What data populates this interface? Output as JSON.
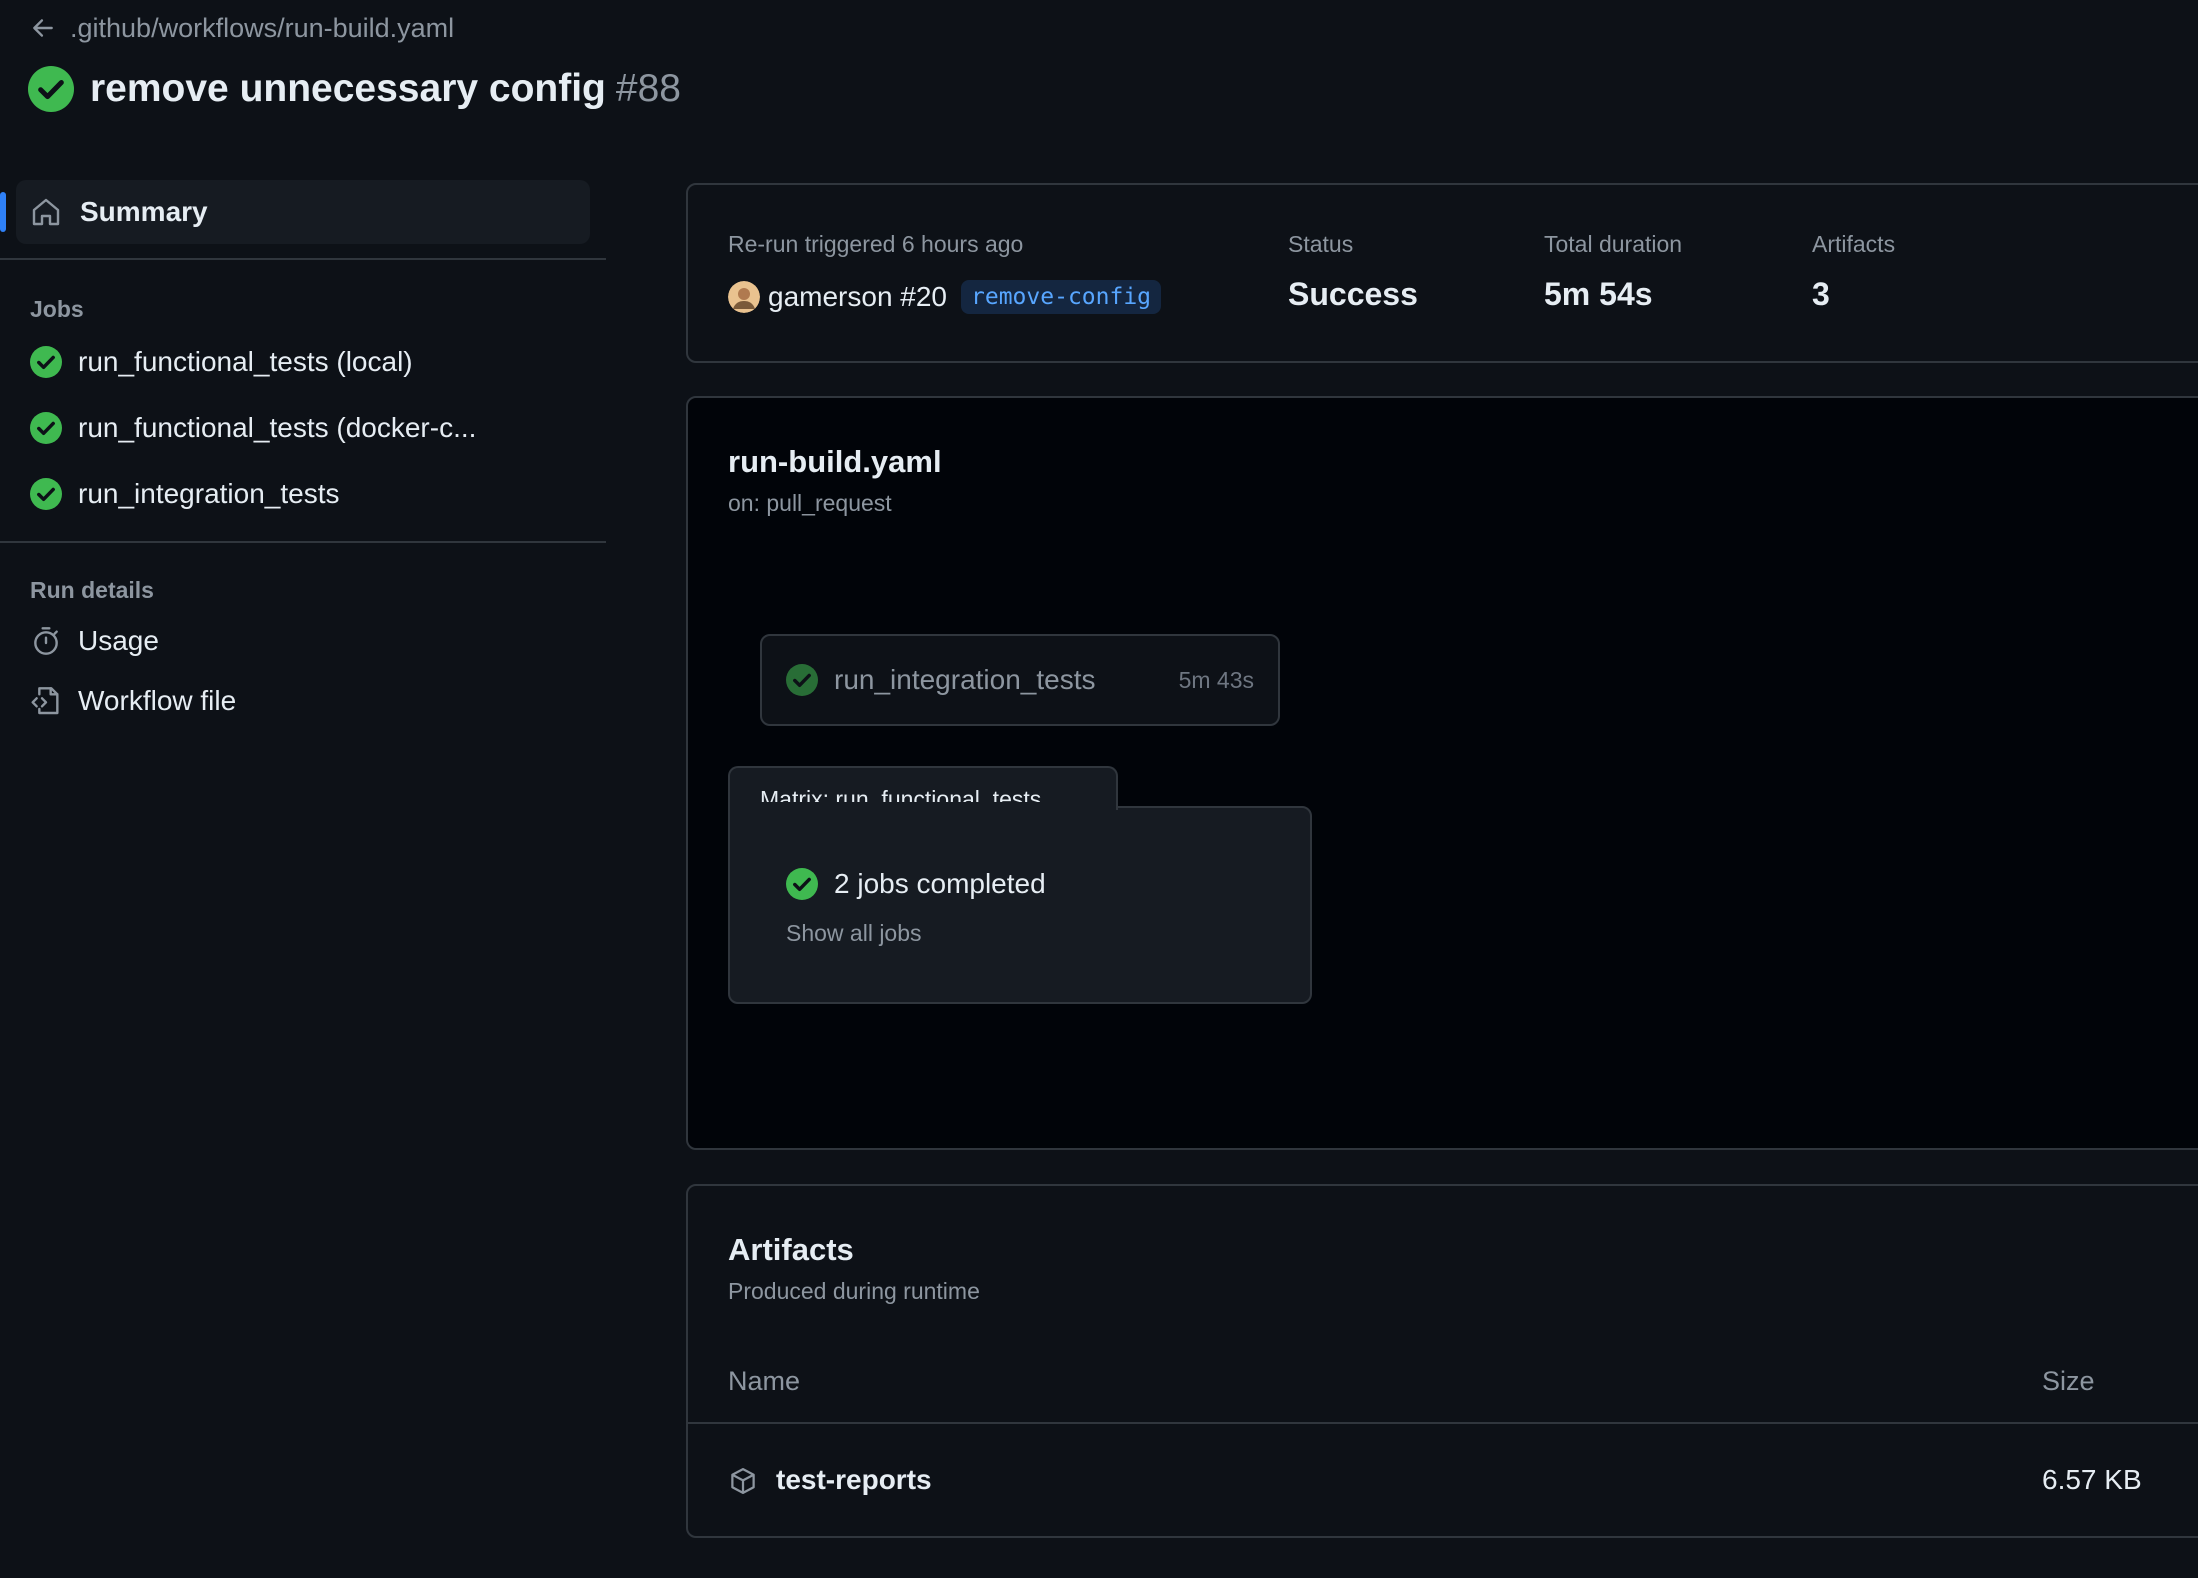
{
  "header": {
    "breadcrumb": ".github/workflows/run-build.yaml",
    "title": "remove unnecessary config",
    "run_number": "#88"
  },
  "sidebar": {
    "summary_label": "Summary",
    "jobs_heading": "Jobs",
    "jobs": [
      {
        "label": "run_functional_tests (local)",
        "status": "success"
      },
      {
        "label": "run_functional_tests (docker-c...",
        "status": "success"
      },
      {
        "label": "run_integration_tests",
        "status": "success"
      }
    ],
    "run_details_heading": "Run details",
    "run_details": [
      {
        "label": "Usage",
        "icon": "stopwatch-icon"
      },
      {
        "label": "Workflow file",
        "icon": "file-code-icon"
      }
    ]
  },
  "summary": {
    "trigger_label": "Re-run triggered 6 hours ago",
    "trigger_user": "gamerson #20",
    "branch": "remove-config",
    "status_label": "Status",
    "status_value": "Success",
    "duration_label": "Total duration",
    "duration_value": "5m 54s",
    "artifacts_label": "Artifacts",
    "artifacts_value": "3"
  },
  "graph": {
    "workflow_name": "run-build.yaml",
    "trigger": "on: pull_request",
    "job": {
      "name": "run_integration_tests",
      "duration": "5m 43s"
    },
    "matrix": {
      "title": "Matrix: run_functional_tests",
      "status": "2 jobs completed",
      "link": "Show all jobs"
    }
  },
  "artifacts": {
    "title": "Artifacts",
    "subtitle": "Produced during runtime",
    "col_name": "Name",
    "col_size": "Size",
    "rows": [
      {
        "name": "test-reports",
        "size": "6.57 KB"
      }
    ]
  },
  "colors": {
    "background": "#0d1117",
    "success": "#3fb950",
    "accent": "#2f81f7",
    "link": "#58a6ff"
  }
}
